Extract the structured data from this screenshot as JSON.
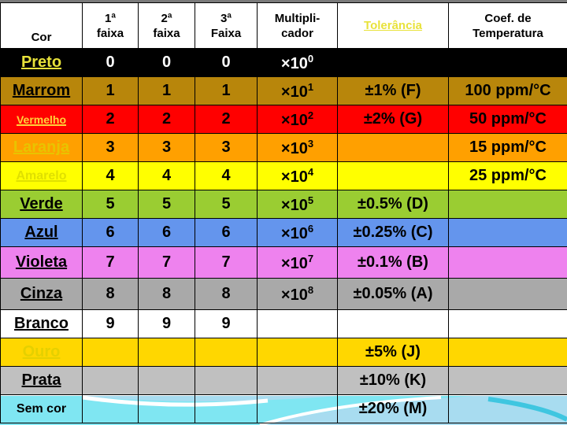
{
  "colors": {
    "header_bg": "#ffffff",
    "name_text": "#e8d835",
    "preto": "#000000",
    "marrom": "#b8860b",
    "vermelho": "#ff0000",
    "laranja": "#ffa000",
    "amarelo": "#ffff00",
    "verde": "#9acd32",
    "azul": "#6495ed",
    "violeta": "#ee82ee",
    "cinza": "#a9a9a9",
    "branco": "#ffffff",
    "ouro": "#ffd700",
    "prata": "#c0c0c0",
    "sem_cor_bg": "#7fe6f2"
  },
  "header": {
    "cor": "Cor",
    "faixa1_line1": "1ª",
    "faixa1_line2": "faixa",
    "faixa2_line1": "2ª",
    "faixa2_line2": "faixa",
    "faixa3_line1": "3ª",
    "faixa3_line2": "Faixa",
    "mult_line1": "Multipli-",
    "mult_line2": "cador",
    "tolerancia": "Tolerância",
    "coef_line1": "Coef. de",
    "coef_line2": "Temperatura"
  },
  "rows": [
    {
      "name": "Preto",
      "f1": "0",
      "f2": "0",
      "f3": "0",
      "mul_base": "×10",
      "mul_exp": "0",
      "tol": "",
      "coef": ""
    },
    {
      "name": "Marrom",
      "f1": "1",
      "f2": "1",
      "f3": "1",
      "mul_base": "×10",
      "mul_exp": "1",
      "tol": "±1% (F)",
      "coef": "100 ppm/°C"
    },
    {
      "name": "Vermelho",
      "f1": "2",
      "f2": "2",
      "f3": "2",
      "mul_base": "×10",
      "mul_exp": "2",
      "tol": "±2% (G)",
      "coef": "50 ppm/°C"
    },
    {
      "name": "Laranja",
      "f1": "3",
      "f2": "3",
      "f3": "3",
      "mul_base": "×10",
      "mul_exp": "3",
      "tol": "",
      "coef": "15 ppm/°C"
    },
    {
      "name": "Amarelo",
      "f1": "4",
      "f2": "4",
      "f3": "4",
      "mul_base": "×10",
      "mul_exp": "4",
      "tol": "",
      "coef": "25 ppm/°C"
    },
    {
      "name": "Verde",
      "f1": "5",
      "f2": "5",
      "f3": "5",
      "mul_base": "×10",
      "mul_exp": "5",
      "tol": "±0.5% (D)",
      "coef": ""
    },
    {
      "name": "Azul",
      "f1": "6",
      "f2": "6",
      "f3": "6",
      "mul_base": "×10",
      "mul_exp": "6",
      "tol": "±0.25% (C)",
      "coef": ""
    },
    {
      "name": "Violeta",
      "f1": "7",
      "f2": "7",
      "f3": "7",
      "mul_base": "×10",
      "mul_exp": "7",
      "tol": "±0.1% (B)",
      "coef": ""
    },
    {
      "name": "Cinza",
      "f1": "8",
      "f2": "8",
      "f3": "8",
      "mul_base": "×10",
      "mul_exp": "8",
      "tol": "±0.05% (A)",
      "coef": ""
    },
    {
      "name": "Branco",
      "f1": "9",
      "f2": "9",
      "f3": "9",
      "mul_base": "",
      "mul_exp": "",
      "tol": "",
      "coef": ""
    },
    {
      "name": "Ouro",
      "f1": "",
      "f2": "",
      "f3": "",
      "mul_base": "",
      "mul_exp": "",
      "tol": "±5% (J)",
      "coef": ""
    },
    {
      "name": "Prata",
      "f1": "",
      "f2": "",
      "f3": "",
      "mul_base": "",
      "mul_exp": "",
      "tol": "±10% (K)",
      "coef": ""
    },
    {
      "name": "Sem cor",
      "f1": "",
      "f2": "",
      "f3": "",
      "mul_base": "",
      "mul_exp": "",
      "tol": "±20% (M)",
      "coef": ""
    }
  ]
}
